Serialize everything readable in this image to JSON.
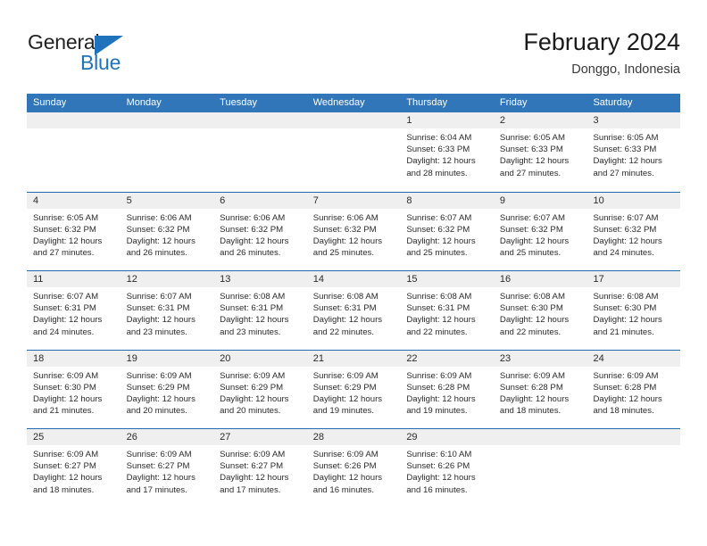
{
  "brand": {
    "name_top": "General",
    "name_bottom": "Blue",
    "flag_icon": "blue-triangle-flag",
    "color_text": "#222222",
    "color_blue": "#1f73bd"
  },
  "header": {
    "title": "February 2024",
    "subtitle": "Donggo, Indonesia"
  },
  "theme": {
    "header_band": "#3176b8",
    "row_divider": "#1f6cb0",
    "day_number_band": "#efefef",
    "cell_background": "#ffffff",
    "text": "#2b2b2b"
  },
  "calendar": {
    "weekday_headers": [
      "Sunday",
      "Monday",
      "Tuesday",
      "Wednesday",
      "Thursday",
      "Friday",
      "Saturday"
    ],
    "weeks": [
      [
        {
          "day": "",
          "empty": true
        },
        {
          "day": "",
          "empty": true
        },
        {
          "day": "",
          "empty": true
        },
        {
          "day": "",
          "empty": true
        },
        {
          "day": "1",
          "sunrise": "Sunrise: 6:04 AM",
          "sunset": "Sunset: 6:33 PM",
          "daylight1": "Daylight: 12 hours",
          "daylight2": "and 28 minutes."
        },
        {
          "day": "2",
          "sunrise": "Sunrise: 6:05 AM",
          "sunset": "Sunset: 6:33 PM",
          "daylight1": "Daylight: 12 hours",
          "daylight2": "and 27 minutes."
        },
        {
          "day": "3",
          "sunrise": "Sunrise: 6:05 AM",
          "sunset": "Sunset: 6:33 PM",
          "daylight1": "Daylight: 12 hours",
          "daylight2": "and 27 minutes."
        }
      ],
      [
        {
          "day": "4",
          "sunrise": "Sunrise: 6:05 AM",
          "sunset": "Sunset: 6:32 PM",
          "daylight1": "Daylight: 12 hours",
          "daylight2": "and 27 minutes."
        },
        {
          "day": "5",
          "sunrise": "Sunrise: 6:06 AM",
          "sunset": "Sunset: 6:32 PM",
          "daylight1": "Daylight: 12 hours",
          "daylight2": "and 26 minutes."
        },
        {
          "day": "6",
          "sunrise": "Sunrise: 6:06 AM",
          "sunset": "Sunset: 6:32 PM",
          "daylight1": "Daylight: 12 hours",
          "daylight2": "and 26 minutes."
        },
        {
          "day": "7",
          "sunrise": "Sunrise: 6:06 AM",
          "sunset": "Sunset: 6:32 PM",
          "daylight1": "Daylight: 12 hours",
          "daylight2": "and 25 minutes."
        },
        {
          "day": "8",
          "sunrise": "Sunrise: 6:07 AM",
          "sunset": "Sunset: 6:32 PM",
          "daylight1": "Daylight: 12 hours",
          "daylight2": "and 25 minutes."
        },
        {
          "day": "9",
          "sunrise": "Sunrise: 6:07 AM",
          "sunset": "Sunset: 6:32 PM",
          "daylight1": "Daylight: 12 hours",
          "daylight2": "and 25 minutes."
        },
        {
          "day": "10",
          "sunrise": "Sunrise: 6:07 AM",
          "sunset": "Sunset: 6:32 PM",
          "daylight1": "Daylight: 12 hours",
          "daylight2": "and 24 minutes."
        }
      ],
      [
        {
          "day": "11",
          "sunrise": "Sunrise: 6:07 AM",
          "sunset": "Sunset: 6:31 PM",
          "daylight1": "Daylight: 12 hours",
          "daylight2": "and 24 minutes."
        },
        {
          "day": "12",
          "sunrise": "Sunrise: 6:07 AM",
          "sunset": "Sunset: 6:31 PM",
          "daylight1": "Daylight: 12 hours",
          "daylight2": "and 23 minutes."
        },
        {
          "day": "13",
          "sunrise": "Sunrise: 6:08 AM",
          "sunset": "Sunset: 6:31 PM",
          "daylight1": "Daylight: 12 hours",
          "daylight2": "and 23 minutes."
        },
        {
          "day": "14",
          "sunrise": "Sunrise: 6:08 AM",
          "sunset": "Sunset: 6:31 PM",
          "daylight1": "Daylight: 12 hours",
          "daylight2": "and 22 minutes."
        },
        {
          "day": "15",
          "sunrise": "Sunrise: 6:08 AM",
          "sunset": "Sunset: 6:31 PM",
          "daylight1": "Daylight: 12 hours",
          "daylight2": "and 22 minutes."
        },
        {
          "day": "16",
          "sunrise": "Sunrise: 6:08 AM",
          "sunset": "Sunset: 6:30 PM",
          "daylight1": "Daylight: 12 hours",
          "daylight2": "and 22 minutes."
        },
        {
          "day": "17",
          "sunrise": "Sunrise: 6:08 AM",
          "sunset": "Sunset: 6:30 PM",
          "daylight1": "Daylight: 12 hours",
          "daylight2": "and 21 minutes."
        }
      ],
      [
        {
          "day": "18",
          "sunrise": "Sunrise: 6:09 AM",
          "sunset": "Sunset: 6:30 PM",
          "daylight1": "Daylight: 12 hours",
          "daylight2": "and 21 minutes."
        },
        {
          "day": "19",
          "sunrise": "Sunrise: 6:09 AM",
          "sunset": "Sunset: 6:29 PM",
          "daylight1": "Daylight: 12 hours",
          "daylight2": "and 20 minutes."
        },
        {
          "day": "20",
          "sunrise": "Sunrise: 6:09 AM",
          "sunset": "Sunset: 6:29 PM",
          "daylight1": "Daylight: 12 hours",
          "daylight2": "and 20 minutes."
        },
        {
          "day": "21",
          "sunrise": "Sunrise: 6:09 AM",
          "sunset": "Sunset: 6:29 PM",
          "daylight1": "Daylight: 12 hours",
          "daylight2": "and 19 minutes."
        },
        {
          "day": "22",
          "sunrise": "Sunrise: 6:09 AM",
          "sunset": "Sunset: 6:28 PM",
          "daylight1": "Daylight: 12 hours",
          "daylight2": "and 19 minutes."
        },
        {
          "day": "23",
          "sunrise": "Sunrise: 6:09 AM",
          "sunset": "Sunset: 6:28 PM",
          "daylight1": "Daylight: 12 hours",
          "daylight2": "and 18 minutes."
        },
        {
          "day": "24",
          "sunrise": "Sunrise: 6:09 AM",
          "sunset": "Sunset: 6:28 PM",
          "daylight1": "Daylight: 12 hours",
          "daylight2": "and 18 minutes."
        }
      ],
      [
        {
          "day": "25",
          "sunrise": "Sunrise: 6:09 AM",
          "sunset": "Sunset: 6:27 PM",
          "daylight1": "Daylight: 12 hours",
          "daylight2": "and 18 minutes."
        },
        {
          "day": "26",
          "sunrise": "Sunrise: 6:09 AM",
          "sunset": "Sunset: 6:27 PM",
          "daylight1": "Daylight: 12 hours",
          "daylight2": "and 17 minutes."
        },
        {
          "day": "27",
          "sunrise": "Sunrise: 6:09 AM",
          "sunset": "Sunset: 6:27 PM",
          "daylight1": "Daylight: 12 hours",
          "daylight2": "and 17 minutes."
        },
        {
          "day": "28",
          "sunrise": "Sunrise: 6:09 AM",
          "sunset": "Sunset: 6:26 PM",
          "daylight1": "Daylight: 12 hours",
          "daylight2": "and 16 minutes."
        },
        {
          "day": "29",
          "sunrise": "Sunrise: 6:10 AM",
          "sunset": "Sunset: 6:26 PM",
          "daylight1": "Daylight: 12 hours",
          "daylight2": "and 16 minutes."
        },
        {
          "day": "",
          "empty": true
        },
        {
          "day": "",
          "empty": true
        }
      ]
    ]
  }
}
